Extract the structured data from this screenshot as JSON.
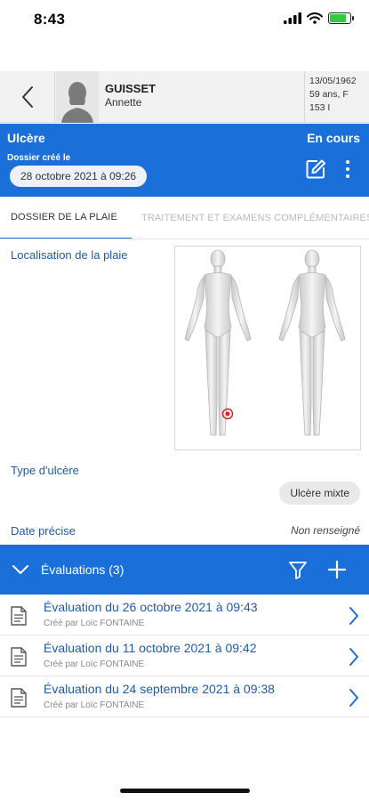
{
  "status_bar": {
    "time": "8:43",
    "battery_level": 0.8,
    "battery_color": "#2ecc40"
  },
  "patient": {
    "last_name": "GUISSET",
    "first_name": "Annette",
    "birth_date": "13/05/1962",
    "age_sex": "59 ans, F",
    "id": "153 I"
  },
  "case": {
    "title": "Ulcère",
    "status": "En cours",
    "created_label": "Dossier créé le",
    "created_date": "28 octobre 2021 à 09:26"
  },
  "tabs": [
    {
      "label": "DOSSIER DE LA PLAIE",
      "active": true
    },
    {
      "label": "TRAITEMENT ET EXAMENS COMPLÉMENTAIRES",
      "active": false
    }
  ],
  "wound": {
    "location_label": "Localisation de la plaie",
    "marker_color": "#e0221f",
    "type_label": "Type d'ulcère",
    "type_value": "Ulcère mixte",
    "date_label": "Date précise",
    "date_value": "Non renseigné"
  },
  "evaluations": {
    "title": "Évaluations (3)",
    "items": [
      {
        "title": "Évaluation du 26 octobre 2021 à 09:43",
        "author": "Créé par Loïc FONTAINE"
      },
      {
        "title": "Évaluation du 11 octobre 2021 à 09:42",
        "author": "Créé par Loïc FONTAINE"
      },
      {
        "title": "Évaluation du 24 septembre 2021 à 09:38",
        "author": "Créé par Loïc FONTAINE"
      }
    ]
  },
  "colors": {
    "primary": "#1a6fd8",
    "link": "#1f5ba8"
  },
  "icons": {
    "back": "chevron-left-icon",
    "avatar": "person-silhouette-icon",
    "edit": "edit-icon",
    "more": "more-vertical-icon",
    "toggle": "chevron-down-icon",
    "filter": "filter-icon",
    "add": "plus-icon",
    "document": "document-icon",
    "row": "chevron-right-icon"
  }
}
